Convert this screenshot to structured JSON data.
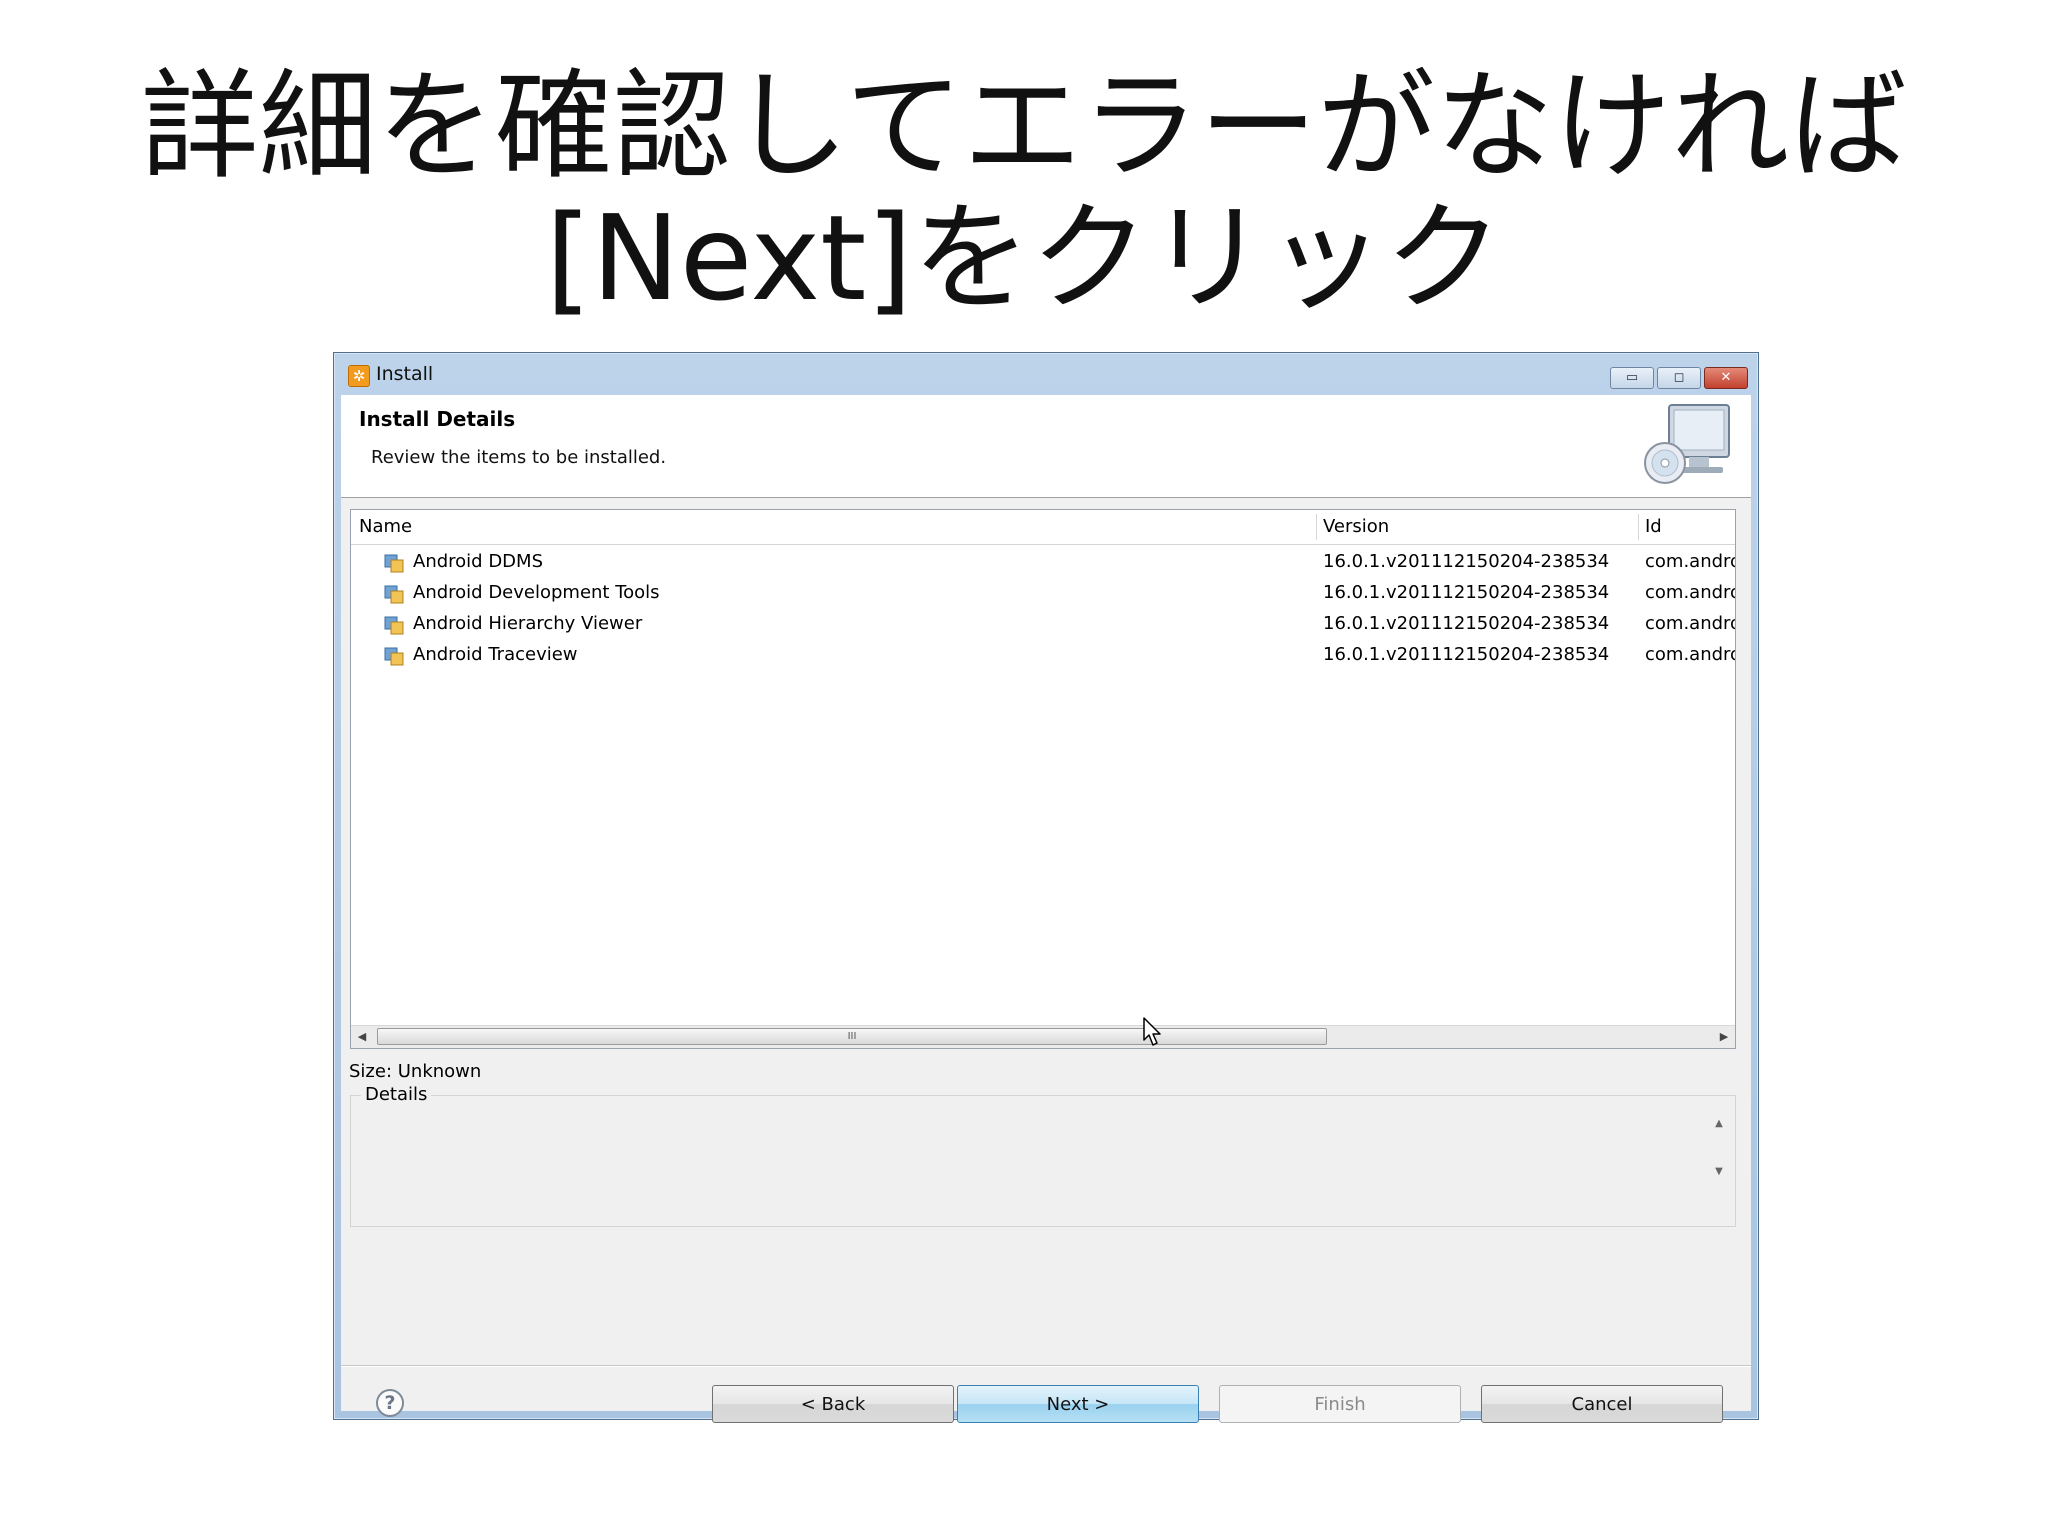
{
  "slide": {
    "title_line1": "詳細を確認してエラーがなければ",
    "title_line2_en": "[Next]",
    "title_line2_ja": "をクリック"
  },
  "window": {
    "title": "Install",
    "icon": "eclipse-install-icon",
    "controls": {
      "minimize": "▭",
      "maximize": "◻",
      "close": "✕"
    }
  },
  "header": {
    "title": "Install Details",
    "description": "Review the items to be installed.",
    "art_icon": "computer-disc-icon"
  },
  "table": {
    "columns": [
      "Name",
      "Version",
      "Id"
    ],
    "rows": [
      {
        "name": "Android DDMS",
        "version": "16.0.1.v201112150204-238534",
        "id": "com.andro"
      },
      {
        "name": "Android Development Tools",
        "version": "16.0.1.v201112150204-238534",
        "id": "com.andro"
      },
      {
        "name": "Android Hierarchy Viewer",
        "version": "16.0.1.v201112150204-238534",
        "id": "com.andro"
      },
      {
        "name": "Android Traceview",
        "version": "16.0.1.v201112150204-238534",
        "id": "com.andro"
      }
    ],
    "scroll_thumb_grip": "III"
  },
  "size_label": "Size: Unknown",
  "details": {
    "legend": "Details"
  },
  "buttons": {
    "help": "?",
    "back": "< Back",
    "next": "Next >",
    "finish": "Finish",
    "cancel": "Cancel"
  },
  "colors": {
    "titlebar": "#a9c4e0",
    "next_button": "#98d1ef",
    "close_button": "#c1412d"
  }
}
